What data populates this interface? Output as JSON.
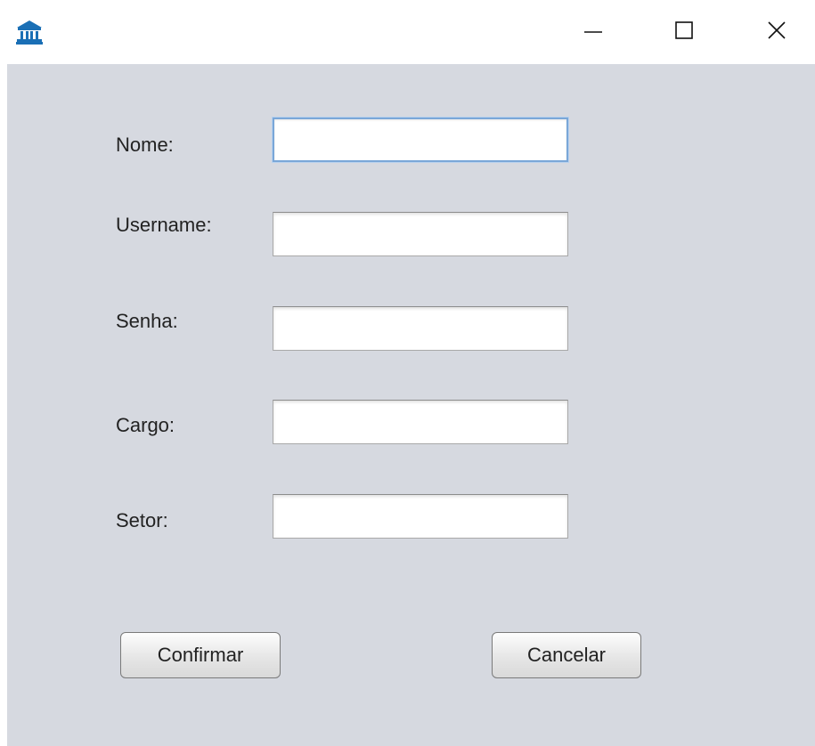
{
  "titlebar": {
    "app_icon": "bank-building-icon",
    "minimize_icon": "minimize-icon",
    "maximize_icon": "maximize-icon",
    "close_icon": "close-icon"
  },
  "form": {
    "nome_label": "Nome:",
    "nome_value": "",
    "username_label": "Username:",
    "username_value": "",
    "senha_label": "Senha:",
    "senha_value": "",
    "cargo_label": "Cargo:",
    "cargo_value": "",
    "setor_label": "Setor:",
    "setor_value": ""
  },
  "buttons": {
    "confirm_label": "Confirmar",
    "cancel_label": "Cancelar"
  },
  "colors": {
    "panel_background": "#d6d9e0",
    "focus_border": "#7aa7d8",
    "app_icon": "#1a6fb5"
  }
}
